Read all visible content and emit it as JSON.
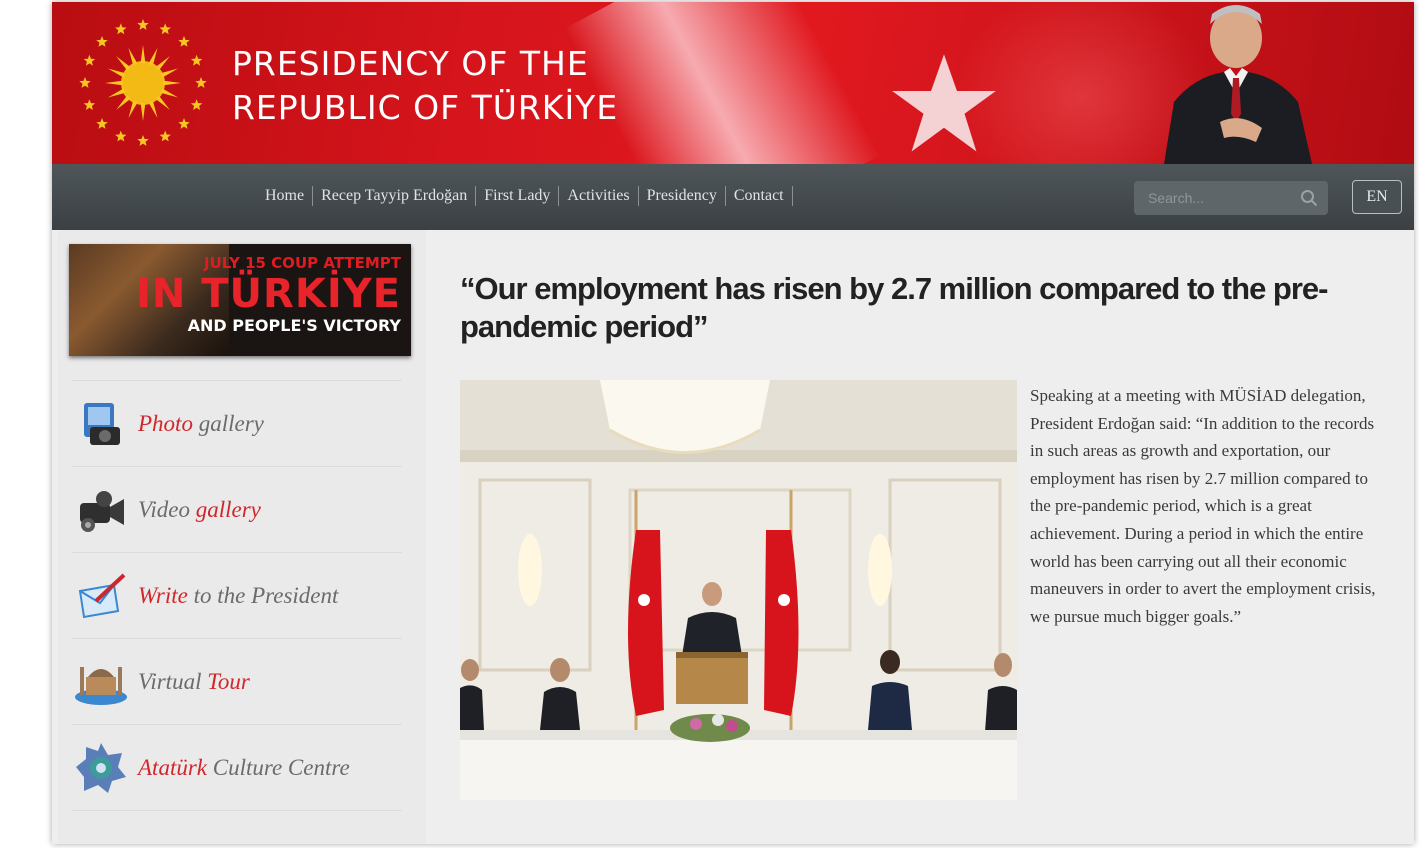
{
  "header": {
    "title_line1": "PRESIDENCY OF THE",
    "title_line2": "REPUBLIC OF TÜRKİYE"
  },
  "nav": {
    "items": [
      {
        "label": "Home"
      },
      {
        "label": "Recep Tayyip Erdoğan"
      },
      {
        "label": "First Lady"
      },
      {
        "label": "Activities"
      },
      {
        "label": "Presidency"
      },
      {
        "label": "Contact"
      }
    ],
    "search_placeholder": "Search...",
    "language": "EN"
  },
  "promo": {
    "line1": "JULY 15 COUP ATTEMPT",
    "line2": "IN TÜRKİYE",
    "line3": "AND PEOPLE'S VICTORY"
  },
  "sidebar": {
    "items": [
      {
        "icon": "camera-icon",
        "part1": "Photo",
        "part2": " gallery"
      },
      {
        "icon": "video-camera-icon",
        "part1": "Video ",
        "part2": "gallery"
      },
      {
        "icon": "letter-pen-icon",
        "part1": "Write",
        "part2": " to the President"
      },
      {
        "icon": "mosque-icon",
        "part1": "Virtual ",
        "part2": "Tour"
      },
      {
        "icon": "pattern-icon",
        "part1": "Atatürk",
        "part2": " Culture Centre"
      }
    ]
  },
  "article": {
    "headline": "“Our employment has risen by 2.7 million compared to the pre-pandemic period”",
    "body": "Speaking at a meeting with MÜSİAD delegation, President Erdoğan said: “In addition to the records in such areas as growth and exportation, our employment has risen by 2.7 million compared to the pre-pandemic period, which is a great achievement. During a period in which the entire world has been carrying out all their economic maneuvers in order to avert the employment crisis, we pursue much bigger goals.”"
  },
  "colors": {
    "brand_red": "#d5141b",
    "nav_bg": "#454c4f",
    "highlight_red": "#d0272c"
  }
}
